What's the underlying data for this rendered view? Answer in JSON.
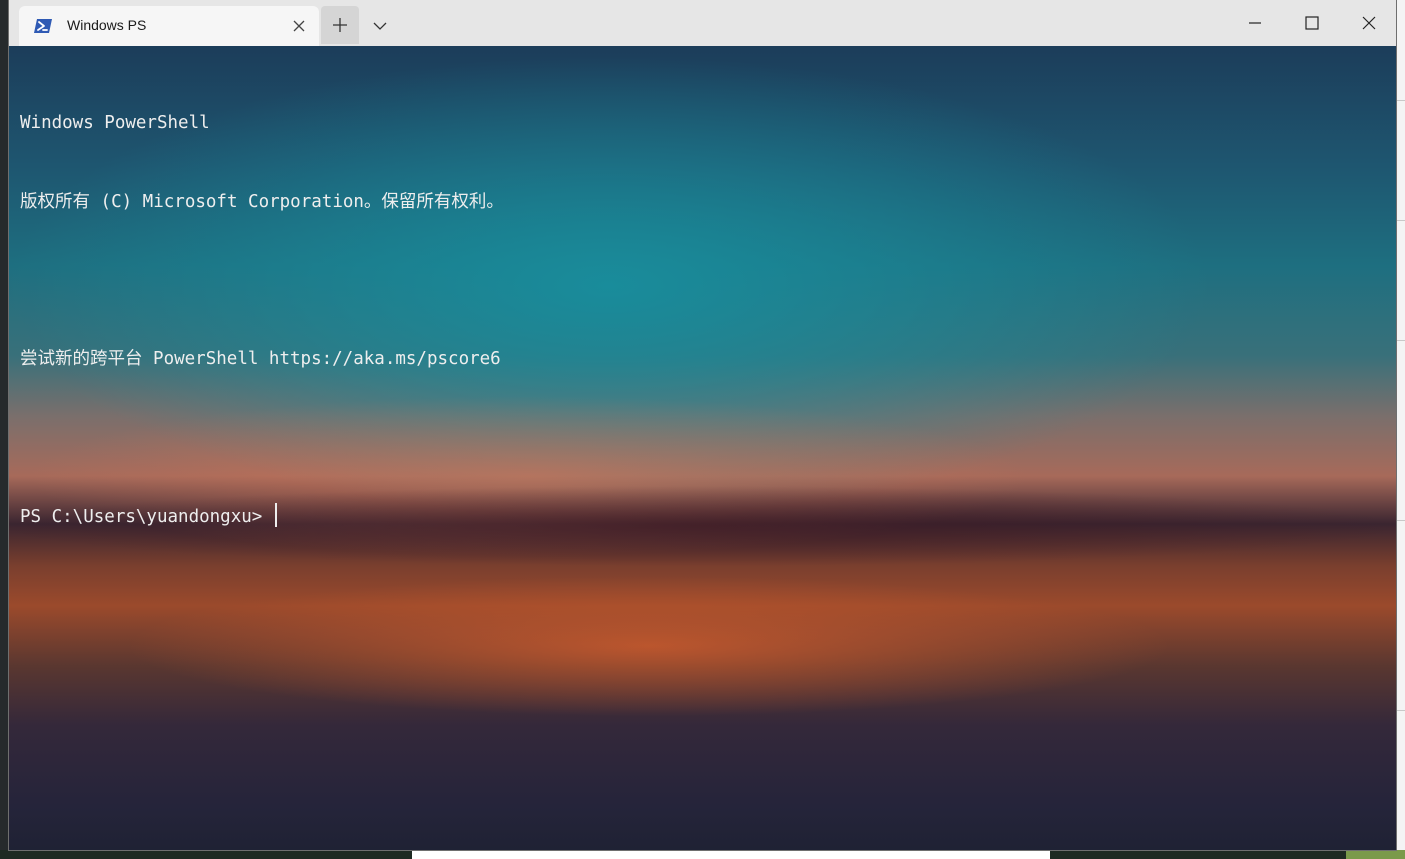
{
  "window": {
    "tab_title": "Windows PS",
    "icons": {
      "tab_icon": "powershell-icon",
      "tab_close": "close-icon",
      "new_tab": "plus-icon",
      "dropdown": "chevron-down-icon",
      "minimize": "minimize-icon",
      "maximize": "maximize-icon",
      "close": "close-icon"
    }
  },
  "terminal": {
    "line1": "Windows PowerShell",
    "line2": "版权所有 (C) Microsoft Corporation。保留所有权利。",
    "line3": "",
    "line4": "尝试新的跨平台 PowerShell https://aka.ms/pscore6",
    "line5": "",
    "prompt": "PS C:\\Users\\yuandongxu> "
  },
  "colors": {
    "titlebar": "#e6e6e6",
    "tab_active": "#f6f6f6",
    "text": "#eeeeee",
    "accent_icon": "#2f5ab4"
  }
}
